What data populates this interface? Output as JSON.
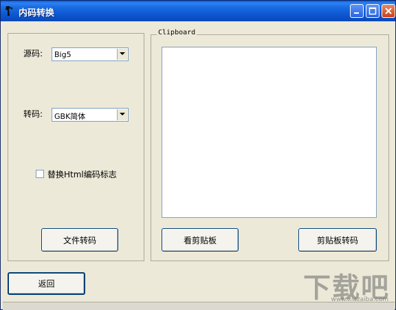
{
  "window": {
    "title": "内码转换"
  },
  "source": {
    "label": "源码:",
    "value": "Big5"
  },
  "target": {
    "label": "转码:",
    "value": "GBK简体"
  },
  "replace_html": {
    "label": "替换Html编码标志",
    "checked": false
  },
  "buttons": {
    "file_convert": "文件转码",
    "view_clipboard": "看剪贴板",
    "clipboard_convert": "剪贴板转码",
    "back": "返回"
  },
  "clipboard": {
    "legend": "Clipboard",
    "content": ""
  },
  "watermark": {
    "text": "下载吧",
    "url": "www.xiazaiba.com"
  },
  "icons": [
    "app-icon",
    "minimize-icon",
    "maximize-icon",
    "close-icon",
    "chevron-down-icon"
  ]
}
